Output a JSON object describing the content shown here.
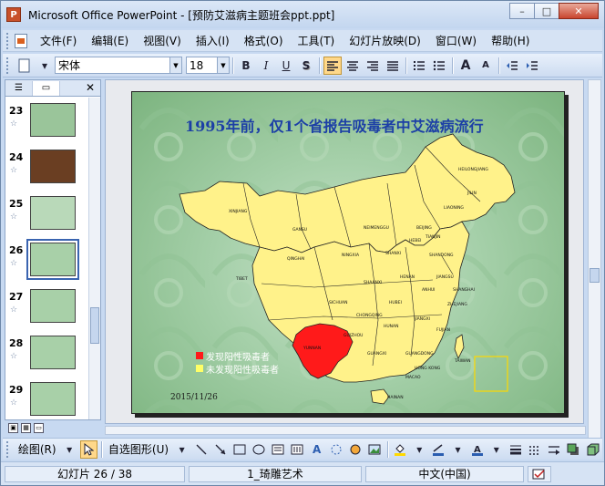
{
  "window": {
    "title": "Microsoft Office PowerPoint - [预防艾滋病主题班会ppt.ppt]",
    "app_icon": "P",
    "minimize": "–",
    "restore": "□",
    "close": "✕"
  },
  "menu": {
    "items": [
      "文件(F)",
      "编辑(E)",
      "视图(V)",
      "插入(I)",
      "格式(O)",
      "工具(T)",
      "幻灯片放映(D)",
      "窗口(W)",
      "帮助(H)"
    ]
  },
  "format_toolbar": {
    "font_name": "宋体",
    "font_size": "18",
    "bold": "B",
    "italic": "I",
    "underline": "U",
    "shadow": "S",
    "grow_font": "A",
    "shrink_font": "A"
  },
  "slide_pane": {
    "tab_outline": "☰",
    "tab_slides": "▭",
    "close": "✕",
    "slides": [
      {
        "num": "23",
        "thumb_color": "#9ac59a",
        "selected": false
      },
      {
        "num": "24",
        "thumb_color": "#6a3e22",
        "selected": false
      },
      {
        "num": "25",
        "thumb_color": "#b9d9b9",
        "selected": false
      },
      {
        "num": "26",
        "thumb_color": "#a8d0a8",
        "selected": true
      },
      {
        "num": "27",
        "thumb_color": "#a8d0a8",
        "selected": false
      },
      {
        "num": "28",
        "thumb_color": "#a8d0a8",
        "selected": false
      },
      {
        "num": "29",
        "thumb_color": "#a8d0a8",
        "selected": false
      }
    ],
    "star": "☆"
  },
  "slide": {
    "title": "1995年前，仅1个省报告吸毒者中艾滋病流行",
    "legend": [
      {
        "label": "发现阳性吸毒者",
        "color": "#ff1a1a"
      },
      {
        "label": "未发现阳性吸毒者",
        "color": "#ffff66"
      }
    ],
    "date": "2015/11/26",
    "map_labels": {
      "heilongjiang": "HEILONGJIANG",
      "jilin": "JILIN",
      "liaoning": "LIAONING",
      "xinjiang": "XINJIANG",
      "gansu": "GANSU",
      "neimenggu": "NEIMENGGU",
      "qinghai": "QINGHAI",
      "tibet": "TIBET",
      "sichuan": "SICHUAN",
      "yunnan": "YUNNAN",
      "guangxi": "GUANGXI",
      "guangdong": "GUANGDONG",
      "hainan": "HAINAN",
      "taiwan": "TAIWAN",
      "hongkong": "HONG KONG",
      "macao": "MACAO",
      "beijing": "BEIJING",
      "tianjin": "TIANJIN",
      "shandong": "SHANDONG",
      "henan": "HENAN",
      "hubei": "HUBEI",
      "hunan": "HUNAN",
      "jiangxi": "JIANGXI",
      "fujian": "FUJIAN",
      "zhejiang": "ZHEJIANG",
      "anhui": "ANHUI",
      "jiangsu": "JIANGSU",
      "shanghai": "SHANGHAI",
      "shanxi": "SHANXI",
      "shaanxi": "SHAANXI",
      "ningxia": "NINGXIA",
      "guizhou": "GUIZHOU",
      "chongqing": "CHONGQING",
      "hebei": "HEBEI"
    }
  },
  "draw_toolbar": {
    "draw_label": "绘图(R)",
    "autoshapes_label": "自选图形(U)"
  },
  "status": {
    "slide_info": "幻灯片 26 / 38",
    "design": "1_琦雕艺术",
    "language": "中文(中国)"
  },
  "colors": {
    "title_blue": "#1c3fa6",
    "map_fill": "#fff28a",
    "highlight_red": "#ff1a1a"
  }
}
